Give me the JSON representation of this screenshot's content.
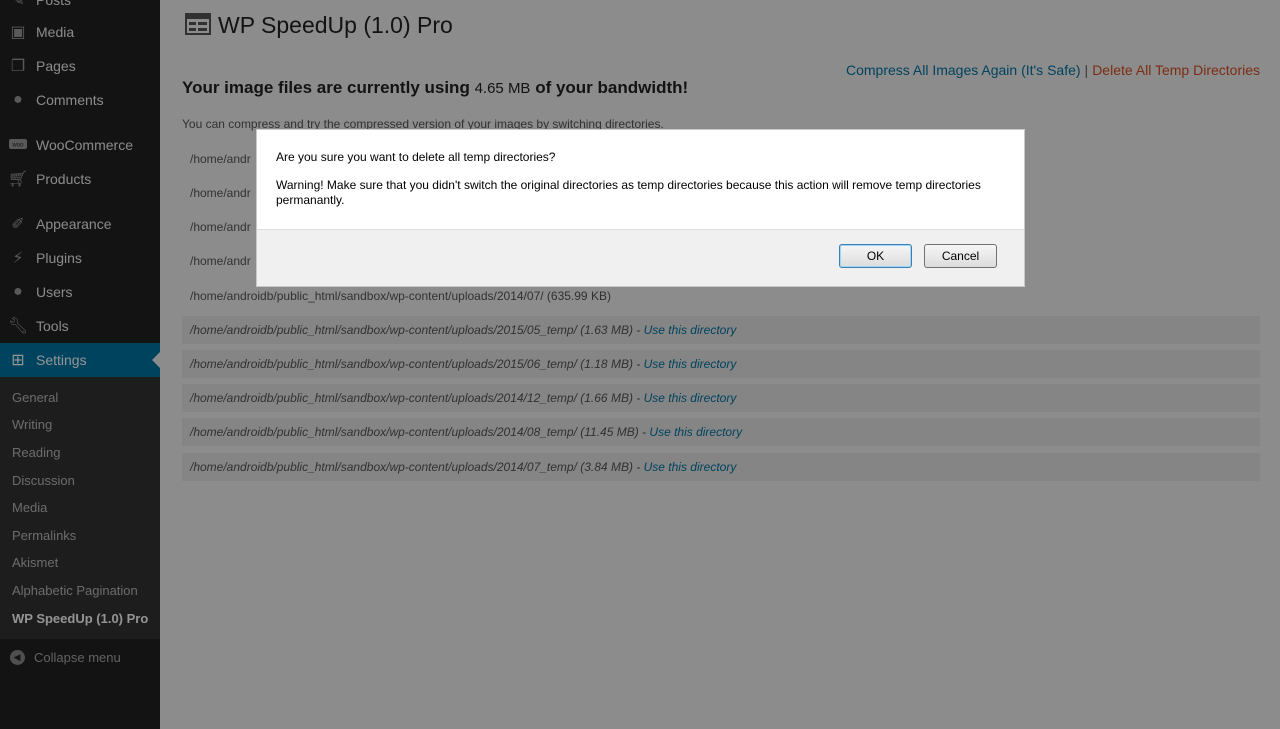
{
  "sidebar": {
    "items": [
      {
        "label": "Posts",
        "icon": "pin-icon"
      },
      {
        "label": "Media",
        "icon": "media-icon"
      },
      {
        "label": "Pages",
        "icon": "pages-icon"
      },
      {
        "label": "Comments",
        "icon": "comments-icon"
      },
      {
        "label": "WooCommerce",
        "icon": "woo-icon"
      },
      {
        "label": "Products",
        "icon": "cart-icon"
      },
      {
        "label": "Appearance",
        "icon": "brush-icon"
      },
      {
        "label": "Plugins",
        "icon": "plug-icon"
      },
      {
        "label": "Users",
        "icon": "user-icon"
      },
      {
        "label": "Tools",
        "icon": "wrench-icon"
      },
      {
        "label": "Settings",
        "icon": "settings-icon"
      }
    ],
    "submenu": [
      "General",
      "Writing",
      "Reading",
      "Discussion",
      "Media",
      "Permalinks",
      "Akismet",
      "Alphabetic Pagination",
      "WP SpeedUp (1.0) Pro"
    ],
    "collapse_label": "Collapse menu"
  },
  "page": {
    "title": "WP SpeedUp (1.0) Pro",
    "compress_link": "Compress All Images Again (It's Safe)",
    "separator": "|",
    "delete_link": "Delete All Temp Directories",
    "headline_pre": "Your image files are currently using",
    "headline_size": "4.65 MB",
    "headline_post": "of your bandwidth!",
    "description": "You can compress and try the compressed version of your images by switching directories.",
    "directories": [
      {
        "path": "/home/andr"
      },
      {
        "path": "/home/andr"
      },
      {
        "path": "/home/andr"
      },
      {
        "path": "/home/andr"
      },
      {
        "path": "/home/androidb/public_html/sandbox/wp-content/uploads/2014/07/ (635.99 KB)"
      }
    ],
    "temp_directories": [
      {
        "path": "/home/androidb/public_html/sandbox/wp-content/uploads/2015/05_temp/ (1.63 MB) -",
        "link": "Use this directory"
      },
      {
        "path": "/home/androidb/public_html/sandbox/wp-content/uploads/2015/06_temp/ (1.18 MB) -",
        "link": "Use this directory"
      },
      {
        "path": "/home/androidb/public_html/sandbox/wp-content/uploads/2014/12_temp/ (1.66 MB) -",
        "link": "Use this directory"
      },
      {
        "path": "/home/androidb/public_html/sandbox/wp-content/uploads/2014/08_temp/ (11.45 MB) -",
        "link": "Use this directory"
      },
      {
        "path": "/home/androidb/public_html/sandbox/wp-content/uploads/2014/07_temp/ (3.84 MB) -",
        "link": "Use this directory"
      }
    ]
  },
  "dialog": {
    "question": "Are you sure you want to delete all temp directories?",
    "warning": "Warning! Make sure that you didn't switch the original directories as temp directories because this action will remove temp directories permanantly.",
    "ok_label": "OK",
    "cancel_label": "Cancel"
  },
  "colors": {
    "sidebar_bg": "#222222",
    "accent": "#0074a2",
    "danger": "#d54e21"
  }
}
